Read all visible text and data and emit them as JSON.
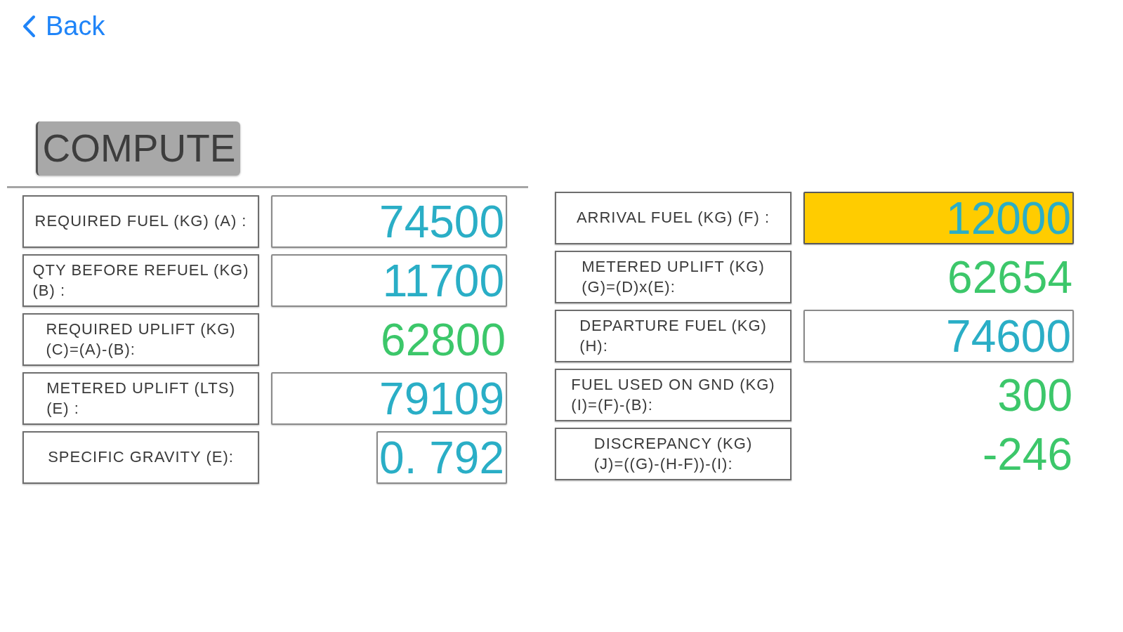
{
  "nav": {
    "back": "Back"
  },
  "compute_button": "COMPUTE",
  "left_fields": [
    {
      "label": "REQUIRED FUEL (KG) (A) :",
      "value": "74500",
      "kind": "input",
      "highlighted": false
    },
    {
      "label": "QTY BEFORE REFUEL (KG)\n(B) :",
      "value": "11700",
      "kind": "input",
      "highlighted": false
    },
    {
      "label": "REQUIRED UPLIFT (KG)\n(C)=(A)-(B):",
      "value": "62800",
      "kind": "computed",
      "highlighted": false
    },
    {
      "label": "METERED UPLIFT (LTS)\n(E) :",
      "value": "79109",
      "kind": "input",
      "highlighted": false
    },
    {
      "label": "SPECIFIC GRAVITY (E):",
      "value": "0. 792",
      "kind": "compact",
      "highlighted": false
    }
  ],
  "right_fields": [
    {
      "label": "ARRIVAL FUEL (KG) (F) :",
      "value": "12000",
      "kind": "input",
      "highlighted": true
    },
    {
      "label": "METERED UPLIFT (KG)\n(G)=(D)x(E):",
      "value": "62654",
      "kind": "computed",
      "highlighted": false
    },
    {
      "label": "DEPARTURE FUEL (KG)\n(H):",
      "value": "74600",
      "kind": "input",
      "highlighted": false
    },
    {
      "label": "FUEL USED ON GND (KG)\n(I)=(F)-(B):",
      "value": "300",
      "kind": "computed",
      "highlighted": false
    },
    {
      "label": "DISCREPANCY (KG)\n(J)=((G)-(H-F))-(I):",
      "value": "-246",
      "kind": "computed",
      "highlighted": false
    }
  ]
}
